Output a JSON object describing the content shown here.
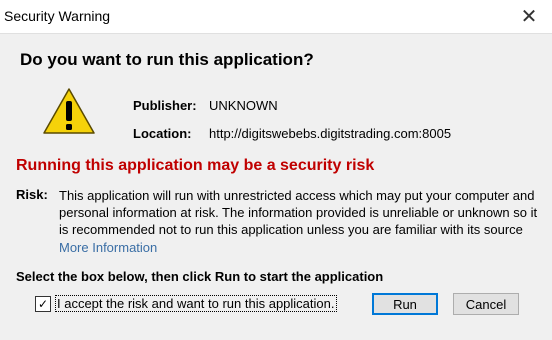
{
  "window": {
    "title": "Security Warning",
    "close_glyph": "✕"
  },
  "question": "Do you want to run this application?",
  "publisher": {
    "label": "Publisher:",
    "value": "UNKNOWN"
  },
  "location": {
    "label": "Location:",
    "value": "http://digitswebebs.digitstrading.com:8005"
  },
  "risk_heading": "Running this application may be a security risk",
  "risk": {
    "label": "Risk:",
    "text": "This application will run with unrestricted access which may put your computer and personal information at risk. The information provided is unreliable or unknown so it is recommended not to run this application unless you are familiar with its source"
  },
  "more_info": "More Information",
  "instruction": "Select the box below, then click Run to start the application",
  "accept": {
    "label": "I accept the risk and want to run this application.",
    "checked": true,
    "check_glyph": "✓"
  },
  "buttons": {
    "run": "Run",
    "cancel": "Cancel"
  },
  "colors": {
    "risk_heading": "#c00000",
    "link": "#3a6ea5",
    "warning_icon": "#f5d20a"
  },
  "icons": {
    "warning": "warning-triangle-icon"
  }
}
